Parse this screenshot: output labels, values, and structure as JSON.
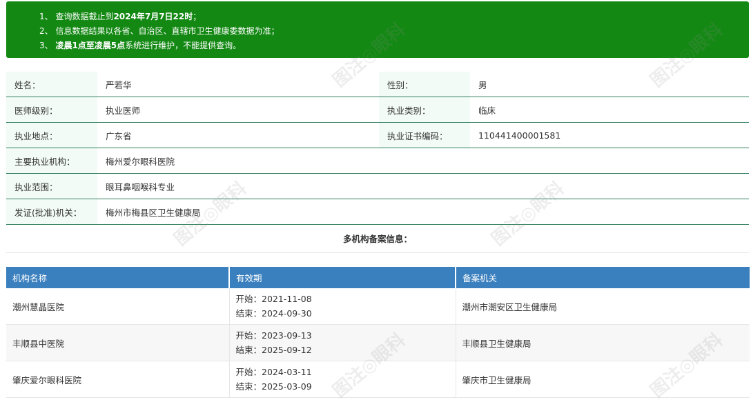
{
  "notice": {
    "line1_prefix": "1、 查询数据截止到",
    "line1_bold": "2024年7月7日22时",
    "line1_suffix": "；",
    "line2": "2、 信息数据结果以各省、自治区、直辖市卫生健康委数据为准；",
    "line3_prefix": "3、 ",
    "line3_bold": "凌晨1点至凌晨5点",
    "line3_suffix": "系统进行维护，不能提供查询。"
  },
  "info": {
    "name_label": "姓名：",
    "name_value": "严若华",
    "gender_label": "性别：",
    "gender_value": "男",
    "level_label": "医师级别：",
    "level_value": "执业医师",
    "category_label": "执业类别：",
    "category_value": "临床",
    "place_label": "执业地点：",
    "place_value": "广东省",
    "cert_label": "执业证书编码：",
    "cert_value": "110441400001581",
    "org_label": "主要执业机构：",
    "org_value": "梅州爱尔眼科医院",
    "scope_label": "执业范围：",
    "scope_value": "眼耳鼻咽喉科专业",
    "issuer_label": "发证(批准)机关：",
    "issuer_value": "梅州市梅县区卫生健康局"
  },
  "multi": {
    "title": "多机构备案信息：",
    "headers": [
      "机构名称",
      "有效期",
      "备案机关"
    ],
    "rows": [
      {
        "org": "潮州慧晶医院",
        "start": "开始：2021-11-08",
        "end": "结束：2024-09-30",
        "authority": "潮州市潮安区卫生健康局"
      },
      {
        "org": "丰顺县中医院",
        "start": "开始：2023-09-13",
        "end": "结束：2025-09-12",
        "authority": "丰顺县卫生健康局"
      },
      {
        "org": "肇庆爱尔眼科医院",
        "start": "开始：2024-03-11",
        "end": "结束：2025-03-09",
        "authority": "肇庆市卫生健康局"
      }
    ]
  },
  "watermark": "图注◎眼科"
}
